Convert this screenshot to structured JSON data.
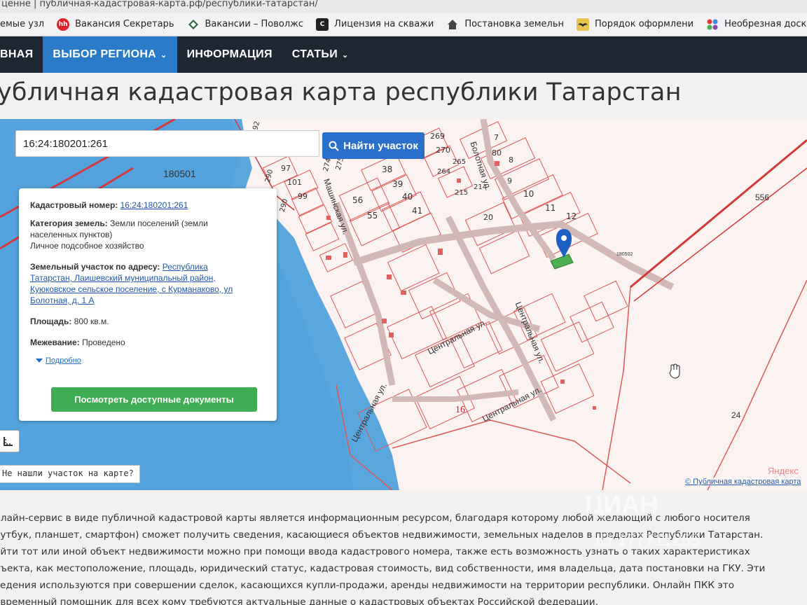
{
  "browser": {
    "url_text": "ценне  |  публичная-кадастровая-карта.рф/республики-татарстан/",
    "bookmarks": [
      {
        "icon": "folder-icon",
        "label": "емые узл"
      },
      {
        "icon": "hh-icon",
        "label": "Вакансия Секретарь"
      },
      {
        "icon": "diamond-icon",
        "label": "Вакансии – Поволжс"
      },
      {
        "icon": "c-icon",
        "label": "Лицензия на скважи"
      },
      {
        "icon": "home-icon",
        "label": "Постановка земельн"
      },
      {
        "icon": "mustache-icon",
        "label": "Порядок оформлени"
      },
      {
        "icon": "dots-icon",
        "label": "Необрезная доска к"
      }
    ]
  },
  "nav": {
    "items": [
      {
        "label": "ВНАЯ",
        "active": false,
        "caret": false
      },
      {
        "label": "ВЫБОР РЕГИОНА",
        "active": true,
        "caret": true
      },
      {
        "label": "ИНФОРМАЦИЯ",
        "active": false,
        "caret": false
      },
      {
        "label": "СТАТЬИ",
        "active": false,
        "caret": true
      }
    ],
    "colors": {
      "bar": "#1f2733",
      "active": "#2a7ac7"
    }
  },
  "page": {
    "title": "убличная кадастровая карта республики Татарстан"
  },
  "search": {
    "value": "16:24:180201:261",
    "button_label": "Найти участок"
  },
  "info": {
    "cadastral_label": "Кадастровый номер:",
    "cadastral_value": "16:24:180201:261",
    "category_label": "Категория земель:",
    "category_value_1": "Земли поселений (земли",
    "category_value_2": "населенных пунктов)",
    "category_use": "Личное подсобное хозяйство",
    "address_label": "Земельный участок по адресу:",
    "address_line_1": "Республика",
    "address_line_2": "Татарстан, Лаишевский муниципальный район,",
    "address_line_3": "Куюковское сельское поселение, с Курманаково, ул",
    "address_line_4": "Болотная, д. 1 А",
    "area_label": "Площадь:",
    "area_value": "800 кв.м.",
    "survey_label": "Межевание:",
    "survey_value": "Проведено",
    "more_label": "Подробно",
    "docs_button": "Посмотреть доступные документы",
    "colors": {
      "docs_button": "#3fae52"
    }
  },
  "map": {
    "labels": {
      "block_180501": "180501",
      "block_556": "556",
      "block_16": "16",
      "block_24": "24",
      "block_180502": "180502"
    },
    "street_names": {
      "mashinskaya": "Машинская ул.",
      "bolotnaya": "Болотная ул.",
      "centralnaya_1": "Центральная ул.",
      "centralnaya_2": "Центральная ул.",
      "centralnaya_3": "Центральная ул.",
      "centralnaya_4": "Центральная ул."
    },
    "parcel_numbers": [
      "97",
      "101",
      "99",
      "56",
      "55",
      "38",
      "39",
      "40",
      "41",
      "269",
      "270",
      "264",
      "265",
      "215",
      "214",
      "80",
      "7",
      "8",
      "9",
      "10",
      "11",
      "12",
      "20",
      "290",
      "290",
      "275",
      "274",
      "92"
    ],
    "not_found": "Не нашли участок на карте?",
    "yandex": "Яндекс",
    "pkk_link": "© Публичная кадастровая карта"
  },
  "description": {
    "lines": [
      "нлайн-сервис в виде публичной кадастровой карты является информационным ресурсом, благодаря которому любой желающий с любого носителя",
      "оутбук, планшет, смартфон) сможет получить сведения, касающиеся объектов недвижимости, земельных наделов в пределах Республики Татарстан.",
      "айти тот или иной объект недвижимости можно при помощи ввода кадастрового номера, также есть возможность узнать о таких характеристиках",
      "бъекта, как местоположение, площадь, юридический статус, кадастровая стоимость, вид собственности, имя владельца, дата постановки на ГКУ. Эти",
      "ведения используются при совершении сделок, касающихся купли-продажи, аренды недвижимости на территории республики. Онлайн ПКК это",
      "овременный помощник для всех кому требуются актуальные данные о кадастровых объектах Российской федерации."
    ]
  },
  "watermark": {
    "line1": "ЦИАН",
    "line2": "ID 177711265"
  }
}
